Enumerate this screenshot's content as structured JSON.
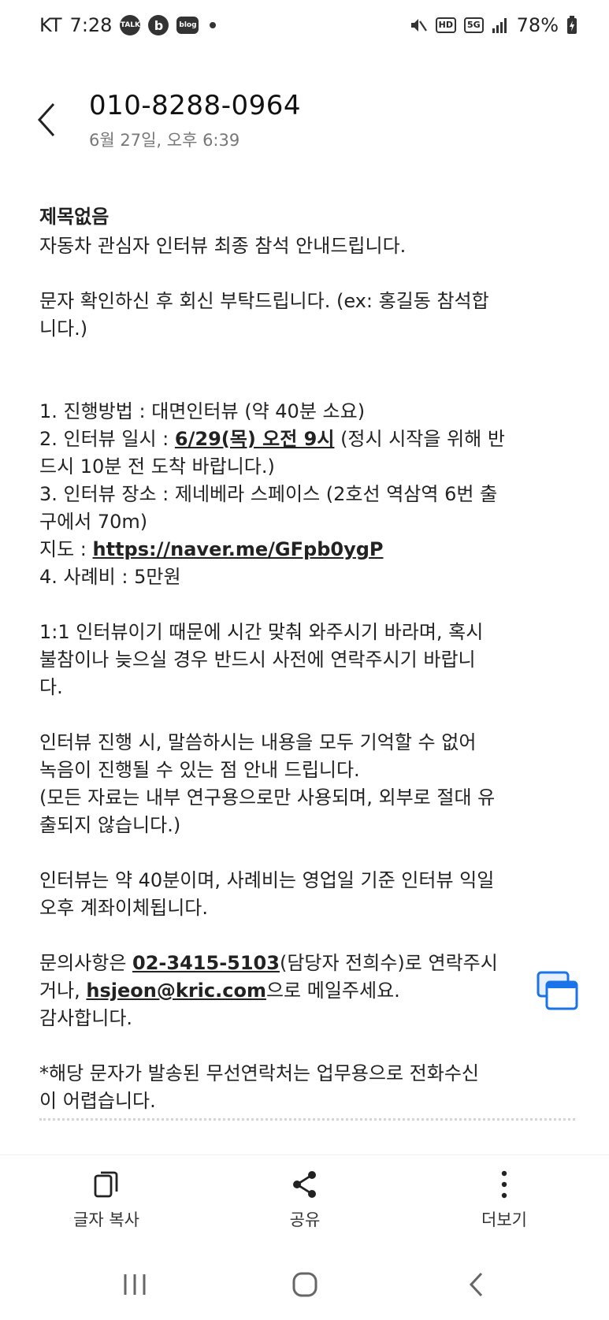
{
  "status_bar": {
    "carrier": "KT",
    "time": "7:28",
    "talk_label": "TALK",
    "b_label": "b",
    "blog_label": "blog",
    "hd_label": "HD",
    "network_label": "5G",
    "battery": "78%"
  },
  "header": {
    "sender": "010-8288-0964",
    "datetime": "6월 27일, 오후 6:39"
  },
  "message": {
    "subject": "제목없음",
    "lines": [
      "자동차 관심자 인터뷰 최종 참석 안내드립니다.",
      "",
      "문자 확인하신 후 회신 부탁드립니다. (ex: 홍길동 참석합",
      "니다.)",
      "",
      "",
      "1. 진행방법 : 대면인터뷰 (약 40분 소요)"
    ],
    "line_interview_prefix": "2. 인터뷰 일시 : ",
    "line_interview_date": "6/29(목) 오전 9시",
    "line_interview_suffix": " (정시 시작을 위해 반",
    "lines2": [
      "드시 10분 전 도착 바랍니다.)",
      "3. 인터뷰 장소 : 제네베라 스페이스 (2호선 역삼역 6번 출",
      "구에서 70m)"
    ],
    "map_prefix": "지도 : ",
    "map_link": "https://naver.me/GFpb0ygP",
    "lines3": [
      "4. 사례비 : 5만원",
      "",
      "1:1 인터뷰이기 때문에 시간 맞춰 와주시기 바라며, 혹시",
      "불참이나 늦으실 경우 반드시 사전에 연락주시기 바랍니",
      "다.",
      "",
      "인터뷰 진행 시, 말씀하시는 내용을 모두 기억할 수 없어",
      "녹음이 진행될 수 있는 점 안내 드립니다.",
      "(모든 자료는 내부 연구용으로만 사용되며, 외부로 절대 유",
      "출되지 않습니다.)",
      "",
      "인터뷰는 약 40분이며, 사례비는 영업일 기준 인터뷰 익일",
      "오후 계좌이체됩니다.",
      ""
    ],
    "contact_prefix": "문의사항은 ",
    "contact_phone": "02-3415-5103",
    "contact_suffix": "(담당자 전희수)로 연락주시",
    "email_prefix": "거나, ",
    "email": "hsjeon@kric.com",
    "email_suffix": "으로 메일주세요.",
    "lines4": [
      "감사합니다.",
      "",
      "*해당 문자가 발송된 무선연락처는 업무용으로 전화수신",
      "이 어렵습니다."
    ]
  },
  "bottom_bar": {
    "copy_label": "글자 복사",
    "share_label": "공유",
    "more_label": "더보기"
  },
  "colors": {
    "link": "#222222",
    "float_button": "#1a73e8",
    "muted": "#777777"
  }
}
